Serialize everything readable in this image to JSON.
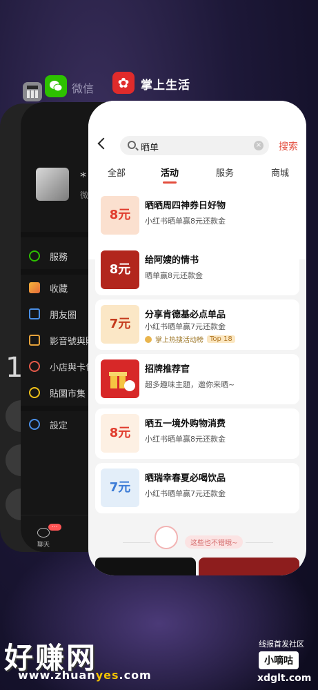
{
  "recents": {
    "calculator": {
      "icon": "calculator-icon"
    },
    "wechat": {
      "label": "微信",
      "icon": "wechat-icon",
      "avatar_caption_fragment": "*",
      "avatar_sub": "微",
      "badge": "···",
      "tab_chat": "聊天",
      "menu": [
        "服務",
        "收藏",
        "朋友圈",
        "影音號與貼",
        "小店與卡包",
        "貼圖市集",
        "設定"
      ]
    },
    "calc_display": "1",
    "app_main": {
      "label": "掌上生活",
      "icon": "flower-logo-icon"
    }
  },
  "main": {
    "search": {
      "value": "晒单",
      "button": "搜索"
    },
    "tabs": [
      "全部",
      "活动",
      "服务",
      "商城"
    ],
    "active_tab": "活动",
    "items": [
      {
        "title": "晒晒周四神券日好物",
        "sub": "小红书晒单赢8元还款金",
        "thumb": "8元",
        "thumb_bg": "#fbe0cf",
        "thumb_fg": "#e03b2d"
      },
      {
        "title": "给阿嫂的情书",
        "sub": "晒单赢8元还款金",
        "thumb": "8元",
        "thumb_bg": "#b2261d",
        "thumb_fg": "#ffffff"
      },
      {
        "title": "分享肯德基必点单品",
        "sub": "小红书晒单赢7元还款金",
        "rank_text": "掌上热搜活动榜",
        "rank_badge": "Top 18",
        "thumb": "7元",
        "thumb_bg": "#fbe7c6",
        "thumb_fg": "#c43a1c"
      },
      {
        "title": "招牌推荐官",
        "sub": "超多趣味主题，邀你来晒~",
        "thumb": "",
        "thumb_bg": "#d72828",
        "thumb_fg": "#ffffff"
      },
      {
        "title": "晒五一境外购物消费",
        "sub": "小红书晒单赢8元还款金",
        "thumb": "8元",
        "thumb_bg": "#fdf0e3",
        "thumb_fg": "#e03b2d"
      },
      {
        "title": "晒瑞幸春夏必喝饮品",
        "sub": "小红书晒单赢7元还款金",
        "thumb": "7元",
        "thumb_bg": "#e3eef9",
        "thumb_fg": "#3b7bd6"
      }
    ],
    "more_divider": "这些也不错哦~"
  },
  "watermark": {
    "left": "好赚网",
    "url_a": "www.zhuan",
    "url_b": "yes",
    "url_c": ".com",
    "right_top": "线报首发社区",
    "right_mid": "小嘀咕",
    "right_bottom": "xdglt.com"
  }
}
